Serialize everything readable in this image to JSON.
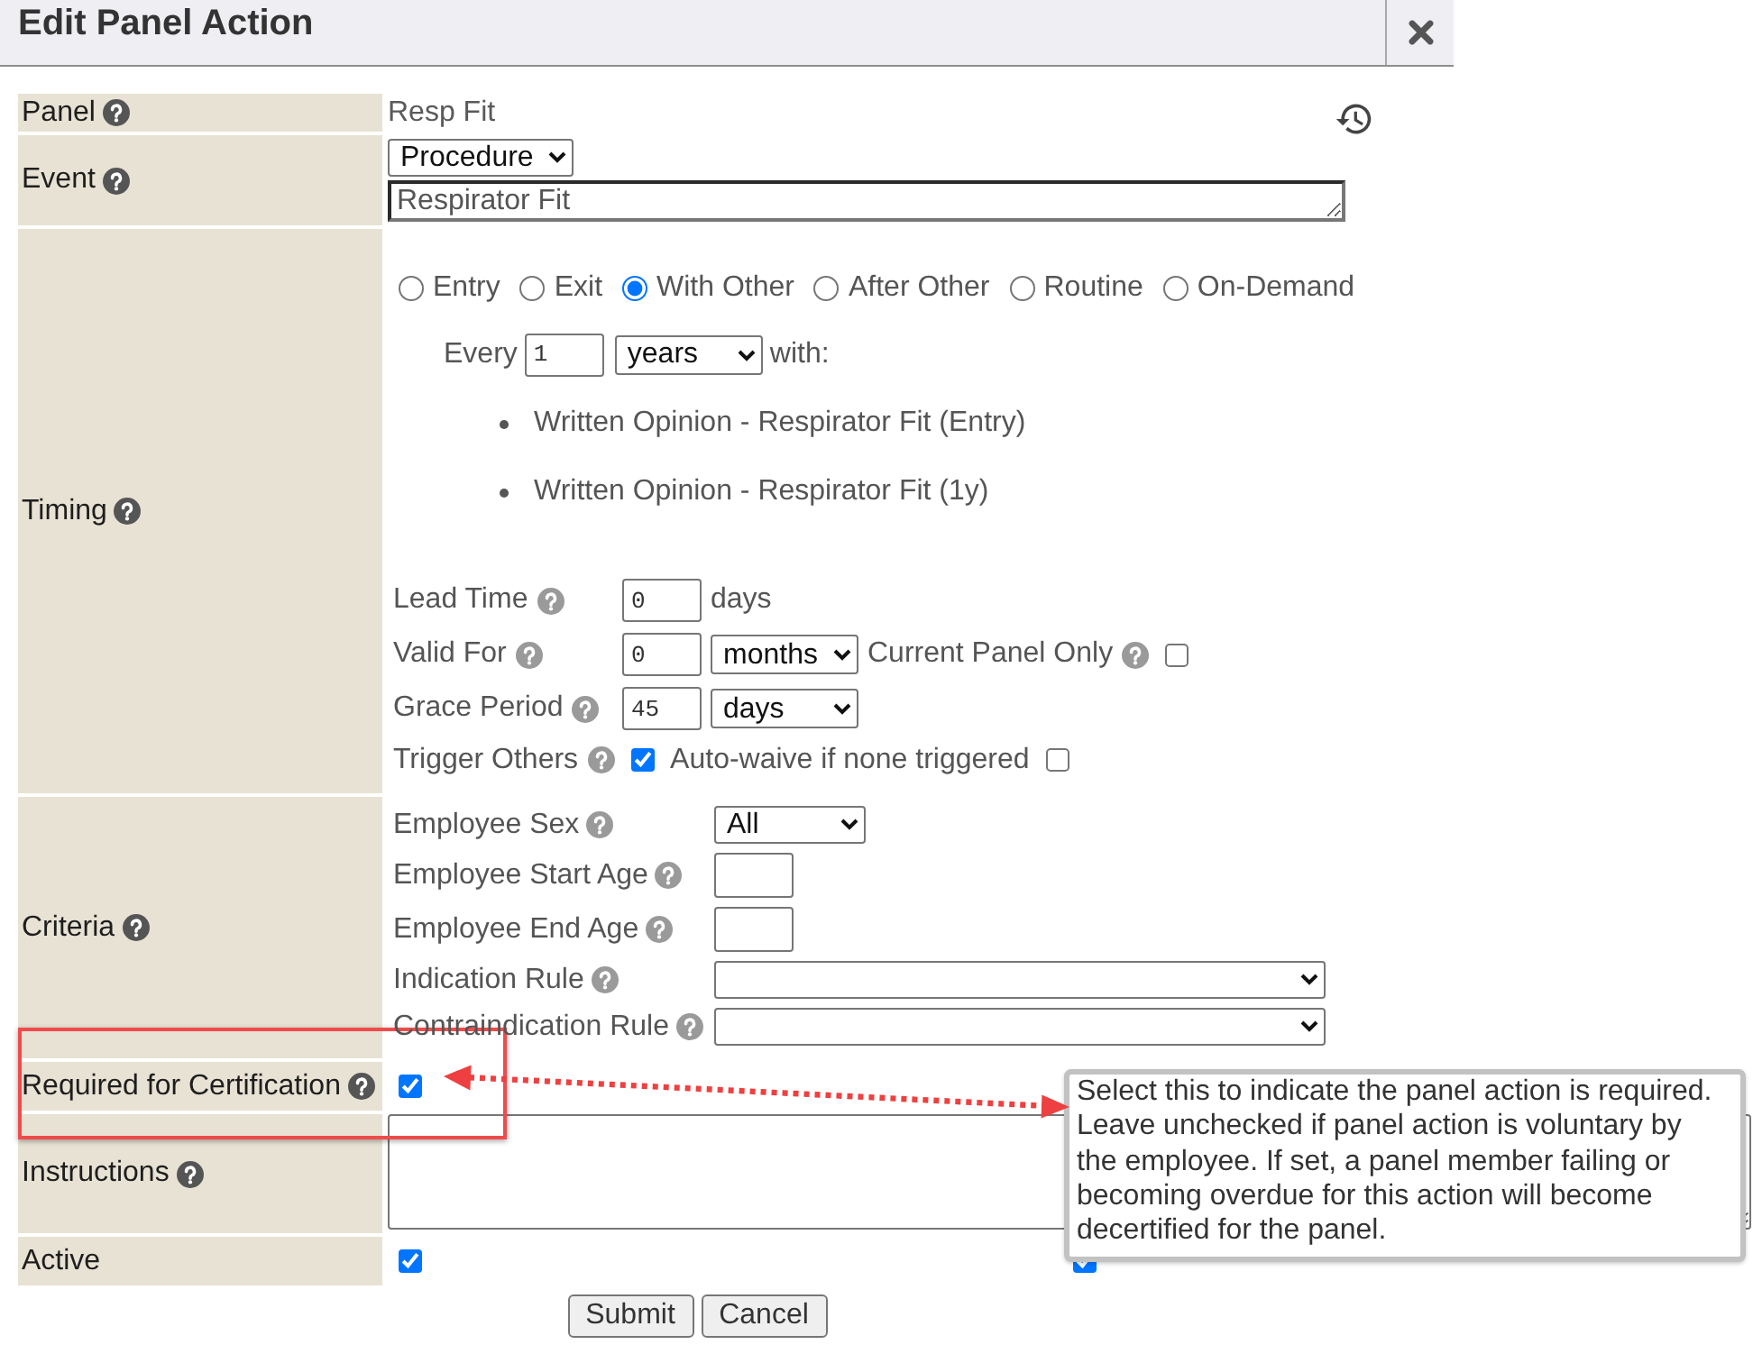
{
  "dialog": {
    "title": "Edit Panel Action"
  },
  "form": {
    "rows": [
      {
        "kind": "text",
        "label": "Panel",
        "help": true,
        "value": "Resp Fit"
      },
      {
        "kind": "event",
        "label": "Event",
        "help": true,
        "event_type": "Procedure",
        "event_name": "Respirator Fit"
      },
      {
        "kind": "timing",
        "label": "Timing",
        "help": true,
        "options": [
          {
            "label": "Entry",
            "selected": false
          },
          {
            "label": "Exit",
            "selected": false
          },
          {
            "label": "With Other",
            "selected": true
          },
          {
            "label": "After Other",
            "selected": false
          },
          {
            "label": "Routine",
            "selected": false
          },
          {
            "label": "On-Demand",
            "selected": false
          }
        ],
        "every": {
          "label": "Every",
          "value": "1",
          "unit": "years",
          "suffix": "with:"
        },
        "linked_actions": [
          "Written Opinion - Respirator Fit (Entry)",
          "Written Opinion - Respirator Fit (1y)"
        ],
        "fields": [
          {
            "label": "Lead Time",
            "help": true,
            "controls": [
              {
                "kind": "input",
                "value": "0"
              },
              {
                "kind": "text",
                "text": "days"
              }
            ]
          },
          {
            "label": "Valid For",
            "help": true,
            "controls": [
              {
                "kind": "input",
                "value": "0"
              },
              {
                "kind": "select",
                "value": "months"
              },
              {
                "kind": "text",
                "text": "Current Panel Only"
              },
              {
                "kind": "help"
              },
              {
                "kind": "checkbox",
                "checked": false
              }
            ]
          },
          {
            "label": "Grace Period",
            "help": true,
            "controls": [
              {
                "kind": "input",
                "value": "45"
              },
              {
                "kind": "select",
                "value": "days"
              }
            ]
          },
          {
            "label": "Trigger Others",
            "help": true,
            "controls": [
              {
                "kind": "checkbox",
                "checked": true
              },
              {
                "kind": "text",
                "text": "Auto-waive if none triggered"
              },
              {
                "kind": "checkbox",
                "checked": false
              }
            ]
          }
        ]
      },
      {
        "kind": "criteria",
        "label": "Criteria",
        "help": true,
        "fields": [
          {
            "label": "Employee Sex",
            "help": true,
            "controls": [
              {
                "kind": "select",
                "value": "All"
              }
            ]
          },
          {
            "label": "Employee Start Age",
            "help": true,
            "controls": [
              {
                "kind": "input"
              }
            ]
          },
          {
            "label": "Employee End Age",
            "help": true,
            "controls": [
              {
                "kind": "input"
              }
            ]
          },
          {
            "label": "Indication Rule",
            "help": true,
            "controls": [
              {
                "kind": "wide-select"
              }
            ]
          },
          {
            "label": "Contraindication Rule",
            "help": true,
            "controls": [
              {
                "kind": "wide-select"
              }
            ]
          }
        ]
      },
      {
        "kind": "checkbox",
        "label": "Required for Certification",
        "help": true,
        "checked": true
      },
      {
        "kind": "textarea",
        "label": "Instructions",
        "help": true
      },
      {
        "kind": "checkboxes",
        "label": "Active",
        "help": false,
        "checks": [
          {
            "checked": true
          },
          {
            "checked": true
          }
        ]
      }
    ]
  },
  "buttons": [
    "Submit",
    "Cancel"
  ],
  "tooltip": {
    "text": "Select this to indicate the panel action is required. Leave unchecked if panel action is voluntary by the employee. If set, a panel member failing or becoming overdue for this action will become decertified for the panel."
  }
}
